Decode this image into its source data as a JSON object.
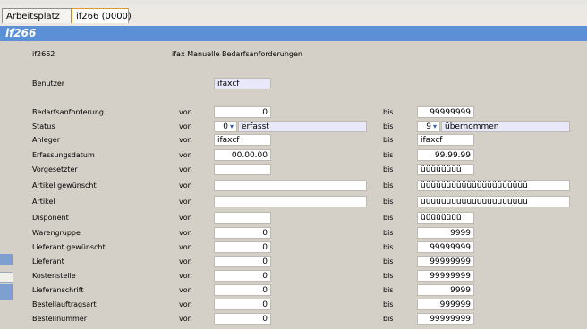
{
  "tabs": [
    {
      "label": "Arbeitsplatz"
    },
    {
      "label": "if266 (0000)"
    }
  ],
  "title": "if266",
  "program": {
    "code": "if2662",
    "description": "ifax  Manuelle Bedarfsanforderungen"
  },
  "user": {
    "label": "Benutzer",
    "value": "ifaxcf"
  },
  "col_von": "von",
  "col_bis": "bis",
  "rows": [
    {
      "label": "Bedarfsanforderung",
      "von": "0",
      "bis": "99999999"
    },
    {
      "label": "Status",
      "von_code": "0",
      "von_text": "erfasst",
      "bis_code": "9",
      "bis_text": "übernommen"
    },
    {
      "label": "Anleger",
      "von": "ifaxcf",
      "bis": "ifaxcf"
    },
    {
      "label": "Erfassungsdatum",
      "von": "00.00.00",
      "bis": "99.99.99"
    },
    {
      "label": "Vorgesetzter",
      "von": "",
      "bis": "üüüüüüüü"
    },
    {
      "label": "Artikel gewünscht",
      "von": "",
      "bis": "üüüüüüüüüüüüüüüüüüüüü"
    },
    {
      "label": "Artikel",
      "von": "",
      "bis": "üüüüüüüüüüüüüüüüüüüüü"
    },
    {
      "label": "Disponent",
      "von": "",
      "bis": "üüüüüüüü"
    },
    {
      "label": "Warengruppe",
      "von": "0",
      "bis": "9999"
    },
    {
      "label": "Lieferant gewünscht",
      "von": "0",
      "bis": "99999999"
    },
    {
      "label": "Lieferant",
      "von": "0",
      "bis": "99999999"
    },
    {
      "label": "Kostenstelle",
      "von": "0",
      "bis": "99999999"
    },
    {
      "label": "Lieferanschrift",
      "von": "0",
      "bis": "9999"
    },
    {
      "label": "Bestellauftragsart",
      "von": "0",
      "bis": "999999"
    },
    {
      "label": "Bestellnummer",
      "von": "0",
      "bis": "99999999"
    }
  ],
  "colors": {
    "titlebar": "#5b8fd6",
    "background": "#d4d0c8",
    "tab_active_border": "#e39a2b"
  }
}
